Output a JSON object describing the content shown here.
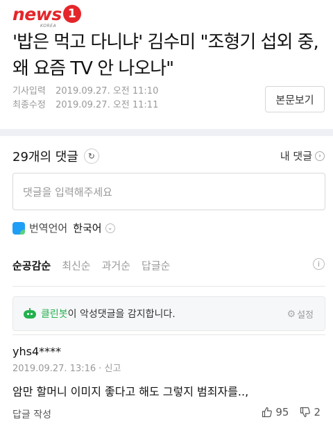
{
  "header": {
    "logo_text": "news",
    "logo_badge": "1",
    "logo_sub": "KOREA",
    "title": "'밥은 먹고 다니냐' 김수미 \"조형기 섭외 중, 왜 요즘 TV 안 나오나\"",
    "published_label": "기사입력",
    "published_value": "2019.09.27. 오전 11:10",
    "updated_label": "최종수정",
    "updated_value": "2019.09.27. 오전 11:11",
    "view_original_label": "본문보기"
  },
  "comments": {
    "count_label": "29개의 댓글",
    "refresh_icon": "refresh-icon",
    "my_comments_label": "내 댓글",
    "input_placeholder": "댓글을 입력해주세요",
    "translate_label": "번역언어",
    "translate_language": "한국어",
    "sort_tabs": [
      "순공감순",
      "최신순",
      "과거순",
      "답글순"
    ],
    "cleanbot_name": "클린봇",
    "cleanbot_message": "이 악성댓글을 감지합니다.",
    "cleanbot_settings_label": "설정"
  },
  "comment_list": [
    {
      "author": "yhs4****",
      "meta": "2019.09.27. 13:16 · 신고",
      "body": "암만 할머니 이미지 좋다고 해도 그렇지 범죄자를..,",
      "reply_label": "답글 작성",
      "likes": "95",
      "dislikes": "2"
    }
  ],
  "colors": {
    "brand_red": "#e4262a",
    "cleanbot_green": "#22b24c",
    "separator": "#eef0f5"
  }
}
